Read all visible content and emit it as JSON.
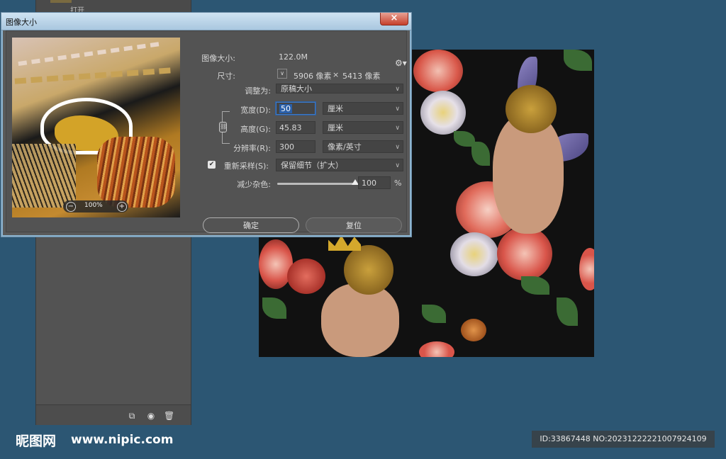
{
  "dialog": {
    "title": "图像大小",
    "close_icon": "×",
    "image_size_label": "图像大小:",
    "image_size_value": "122.0M",
    "dimensions_label": "尺寸:",
    "dimensions_width": "5906 像素",
    "dimensions_x": "×",
    "dimensions_height": "5413 像素",
    "fit_to_label": "调整为:",
    "fit_to_value": "原稿大小",
    "width_label": "宽度(D):",
    "width_value": "50",
    "width_unit": "厘米",
    "height_label": "高度(G):",
    "height_value": "45.83",
    "height_unit": "厘米",
    "resolution_label": "分辨率(R):",
    "resolution_value": "300",
    "resolution_unit": "像素/英寸",
    "resample_label": "重新采样(S):",
    "resample_checked": true,
    "resample_value": "保留细节（扩大）",
    "noise_label": "减少杂色:",
    "noise_value": "100",
    "noise_level_percent": 100,
    "noise_unit": "%",
    "preview_zoom": "100%",
    "ok_label": "确定",
    "reset_label": "复位"
  },
  "background_panel": {
    "label": "打开"
  },
  "watermark": {
    "logo": "昵图网",
    "url": "www.nipic.com",
    "id_text": "ID:33867448 NO:20231222221007924109"
  },
  "colors": {
    "desktop": "#2c5673",
    "dialog_bg": "#535353",
    "accent": "#3c79c8"
  }
}
